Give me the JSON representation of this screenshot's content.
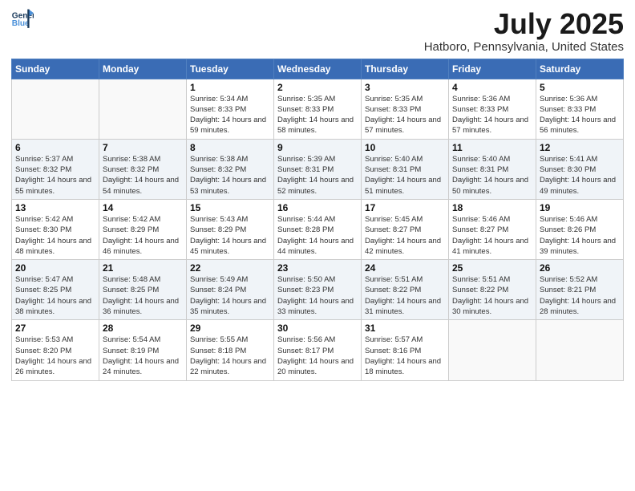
{
  "header": {
    "logo_line1": "General",
    "logo_line2": "Blue",
    "main_title": "July 2025",
    "sub_title": "Hatboro, Pennsylvania, United States"
  },
  "weekdays": [
    "Sunday",
    "Monday",
    "Tuesday",
    "Wednesday",
    "Thursday",
    "Friday",
    "Saturday"
  ],
  "weeks": [
    [
      {
        "day": "",
        "info": ""
      },
      {
        "day": "",
        "info": ""
      },
      {
        "day": "1",
        "info": "Sunrise: 5:34 AM\nSunset: 8:33 PM\nDaylight: 14 hours and 59 minutes."
      },
      {
        "day": "2",
        "info": "Sunrise: 5:35 AM\nSunset: 8:33 PM\nDaylight: 14 hours and 58 minutes."
      },
      {
        "day": "3",
        "info": "Sunrise: 5:35 AM\nSunset: 8:33 PM\nDaylight: 14 hours and 57 minutes."
      },
      {
        "day": "4",
        "info": "Sunrise: 5:36 AM\nSunset: 8:33 PM\nDaylight: 14 hours and 57 minutes."
      },
      {
        "day": "5",
        "info": "Sunrise: 5:36 AM\nSunset: 8:33 PM\nDaylight: 14 hours and 56 minutes."
      }
    ],
    [
      {
        "day": "6",
        "info": "Sunrise: 5:37 AM\nSunset: 8:32 PM\nDaylight: 14 hours and 55 minutes."
      },
      {
        "day": "7",
        "info": "Sunrise: 5:38 AM\nSunset: 8:32 PM\nDaylight: 14 hours and 54 minutes."
      },
      {
        "day": "8",
        "info": "Sunrise: 5:38 AM\nSunset: 8:32 PM\nDaylight: 14 hours and 53 minutes."
      },
      {
        "day": "9",
        "info": "Sunrise: 5:39 AM\nSunset: 8:31 PM\nDaylight: 14 hours and 52 minutes."
      },
      {
        "day": "10",
        "info": "Sunrise: 5:40 AM\nSunset: 8:31 PM\nDaylight: 14 hours and 51 minutes."
      },
      {
        "day": "11",
        "info": "Sunrise: 5:40 AM\nSunset: 8:31 PM\nDaylight: 14 hours and 50 minutes."
      },
      {
        "day": "12",
        "info": "Sunrise: 5:41 AM\nSunset: 8:30 PM\nDaylight: 14 hours and 49 minutes."
      }
    ],
    [
      {
        "day": "13",
        "info": "Sunrise: 5:42 AM\nSunset: 8:30 PM\nDaylight: 14 hours and 48 minutes."
      },
      {
        "day": "14",
        "info": "Sunrise: 5:42 AM\nSunset: 8:29 PM\nDaylight: 14 hours and 46 minutes."
      },
      {
        "day": "15",
        "info": "Sunrise: 5:43 AM\nSunset: 8:29 PM\nDaylight: 14 hours and 45 minutes."
      },
      {
        "day": "16",
        "info": "Sunrise: 5:44 AM\nSunset: 8:28 PM\nDaylight: 14 hours and 44 minutes."
      },
      {
        "day": "17",
        "info": "Sunrise: 5:45 AM\nSunset: 8:27 PM\nDaylight: 14 hours and 42 minutes."
      },
      {
        "day": "18",
        "info": "Sunrise: 5:46 AM\nSunset: 8:27 PM\nDaylight: 14 hours and 41 minutes."
      },
      {
        "day": "19",
        "info": "Sunrise: 5:46 AM\nSunset: 8:26 PM\nDaylight: 14 hours and 39 minutes."
      }
    ],
    [
      {
        "day": "20",
        "info": "Sunrise: 5:47 AM\nSunset: 8:25 PM\nDaylight: 14 hours and 38 minutes."
      },
      {
        "day": "21",
        "info": "Sunrise: 5:48 AM\nSunset: 8:25 PM\nDaylight: 14 hours and 36 minutes."
      },
      {
        "day": "22",
        "info": "Sunrise: 5:49 AM\nSunset: 8:24 PM\nDaylight: 14 hours and 35 minutes."
      },
      {
        "day": "23",
        "info": "Sunrise: 5:50 AM\nSunset: 8:23 PM\nDaylight: 14 hours and 33 minutes."
      },
      {
        "day": "24",
        "info": "Sunrise: 5:51 AM\nSunset: 8:22 PM\nDaylight: 14 hours and 31 minutes."
      },
      {
        "day": "25",
        "info": "Sunrise: 5:51 AM\nSunset: 8:22 PM\nDaylight: 14 hours and 30 minutes."
      },
      {
        "day": "26",
        "info": "Sunrise: 5:52 AM\nSunset: 8:21 PM\nDaylight: 14 hours and 28 minutes."
      }
    ],
    [
      {
        "day": "27",
        "info": "Sunrise: 5:53 AM\nSunset: 8:20 PM\nDaylight: 14 hours and 26 minutes."
      },
      {
        "day": "28",
        "info": "Sunrise: 5:54 AM\nSunset: 8:19 PM\nDaylight: 14 hours and 24 minutes."
      },
      {
        "day": "29",
        "info": "Sunrise: 5:55 AM\nSunset: 8:18 PM\nDaylight: 14 hours and 22 minutes."
      },
      {
        "day": "30",
        "info": "Sunrise: 5:56 AM\nSunset: 8:17 PM\nDaylight: 14 hours and 20 minutes."
      },
      {
        "day": "31",
        "info": "Sunrise: 5:57 AM\nSunset: 8:16 PM\nDaylight: 14 hours and 18 minutes."
      },
      {
        "day": "",
        "info": ""
      },
      {
        "day": "",
        "info": ""
      }
    ]
  ]
}
